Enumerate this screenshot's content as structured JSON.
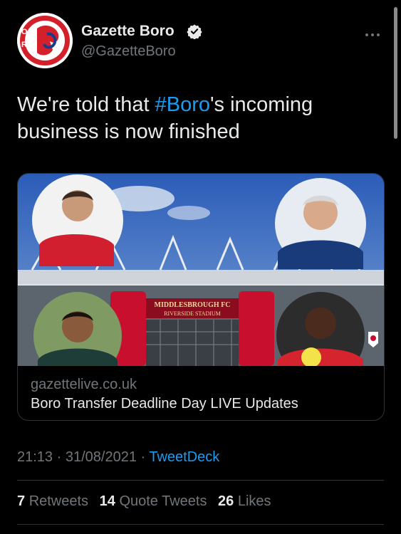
{
  "author": {
    "name": "Gazette Boro",
    "handle": "@GazetteBoro",
    "verified": true,
    "avatar_icon": "gazette-boro-logo-icon"
  },
  "tweet": {
    "text_before": "We're told that ",
    "hashtag": "#Boro",
    "text_after": "'s incoming business is now finished"
  },
  "card": {
    "domain": "gazettelive.co.uk",
    "title": "Boro Transfer Deadline Day LIVE Updates",
    "image": {
      "sign_line1": "MIDDLESBROUGH FC",
      "sign_line2": "RIVERSIDE STADIUM"
    }
  },
  "meta": {
    "time": "21:13",
    "sep1": " · ",
    "date": "31/08/2021",
    "sep2": " · ",
    "source": "TweetDeck"
  },
  "stats": {
    "retweets_count": "7",
    "retweets_label": "Retweets",
    "quotes_count": "14",
    "quotes_label": "Quote Tweets",
    "likes_count": "26",
    "likes_label": "Likes"
  },
  "colors": {
    "background": "#000000",
    "text": "#e7e9ea",
    "secondary": "#71767b",
    "accent": "#1d9bf0",
    "border": "#2f3336",
    "brand_red": "#c8102e"
  },
  "icons": {
    "verified": "verified-badge-icon",
    "more": "more-options-icon"
  }
}
